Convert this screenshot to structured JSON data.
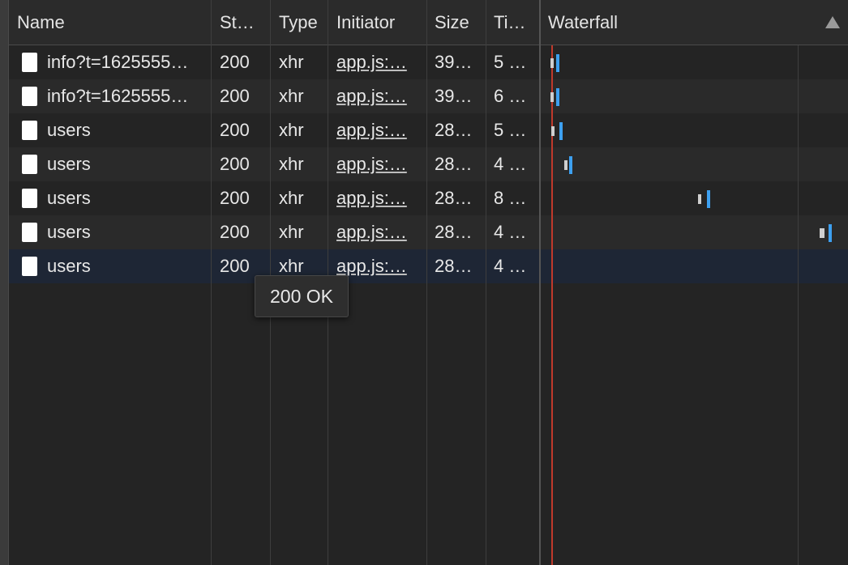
{
  "header": {
    "name": "Name",
    "status": "St…",
    "type": "Type",
    "initiator": "Initiator",
    "size": "Size",
    "time": "Ti…",
    "waterfall": "Waterfall",
    "sort_icon": "triangle-up-icon"
  },
  "rows": [
    {
      "name": "info?t=1625555…",
      "status": "200",
      "type": "xhr",
      "initiator": "app.js:…",
      "size": "39…",
      "time": "5 …"
    },
    {
      "name": "info?t=1625555…",
      "status": "200",
      "type": "xhr",
      "initiator": "app.js:…",
      "size": "39…",
      "time": "6 …"
    },
    {
      "name": "users",
      "status": "200",
      "type": "xhr",
      "initiator": "app.js:…",
      "size": "28…",
      "time": "5 …"
    },
    {
      "name": "users",
      "status": "200",
      "type": "xhr",
      "initiator": "app.js:…",
      "size": "28…",
      "time": "4 …"
    },
    {
      "name": "users",
      "status": "200",
      "type": "xhr",
      "initiator": "app.js:…",
      "size": "28…",
      "time": "8 …"
    },
    {
      "name": "users",
      "status": "200",
      "type": "xhr",
      "initiator": "app.js:…",
      "size": "28…",
      "time": "4 …"
    },
    {
      "name": "users",
      "status": "200",
      "type": "xhr",
      "initiator": "app.js:…",
      "size": "28…",
      "time": "4 …"
    }
  ],
  "tooltip": "200 OK",
  "colors": {
    "background": "#242424",
    "selected_row": "#1e2635",
    "waterfall_download": "#3da0f0",
    "waterfall_load_line": "#c0392b"
  }
}
